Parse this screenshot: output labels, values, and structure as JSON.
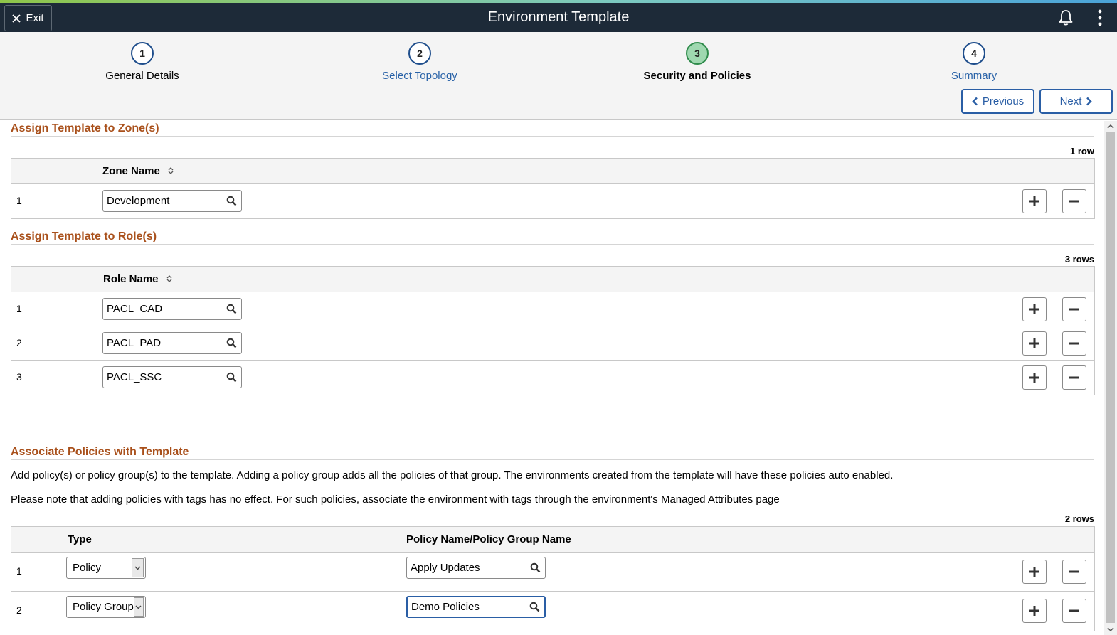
{
  "header": {
    "title": "Environment Template",
    "exit_label": "Exit"
  },
  "train": {
    "steps": [
      {
        "number": "1",
        "label": "General Details",
        "state": "done"
      },
      {
        "number": "2",
        "label": "Select Topology",
        "state": "todo"
      },
      {
        "number": "3",
        "label": "Security and Policies",
        "state": "current"
      },
      {
        "number": "4",
        "label": "Summary",
        "state": "todo"
      }
    ],
    "previous_label": "Previous",
    "next_label": "Next"
  },
  "zones": {
    "title": "Assign Template to Zone(s)",
    "row_count": "1 row",
    "column_header": "Zone Name",
    "rows": [
      {
        "num": "1",
        "value": "Development"
      }
    ]
  },
  "roles": {
    "title": "Assign Template to Role(s)",
    "row_count": "3 rows",
    "column_header": "Role Name",
    "rows": [
      {
        "num": "1",
        "value": "PACL_CAD"
      },
      {
        "num": "2",
        "value": "PACL_PAD"
      },
      {
        "num": "3",
        "value": "PACL_SSC"
      }
    ]
  },
  "policies": {
    "title": "Associate Policies with Template",
    "description_1": "Add policy(s) or policy group(s) to the template. Adding a policy group adds all the policies of that group. The environments created from the template will have these policies auto enabled.",
    "description_2": "Please note that adding policies with tags has no effect. For such policies, associate the environment with tags through the environment's Managed Attributes page",
    "row_count": "2 rows",
    "type_header": "Type",
    "name_header": "Policy Name/Policy Group Name",
    "rows": [
      {
        "num": "1",
        "type": "Policy",
        "name": "Apply Updates"
      },
      {
        "num": "2",
        "type": "Policy Group",
        "name": "Demo Policies"
      }
    ]
  },
  "colors": {
    "header_bg": "#1d2a38",
    "section_title": "#a9501b",
    "link_blue": "#2a63a8",
    "current_step_fill": "#9fd8b0"
  },
  "icons": [
    "close-icon",
    "bell-icon",
    "kebab-menu-icon",
    "sort-icon",
    "search-icon",
    "plus-icon",
    "minus-icon",
    "chevron-left-icon",
    "chevron-right-icon",
    "dropdown-arrow-icon"
  ]
}
